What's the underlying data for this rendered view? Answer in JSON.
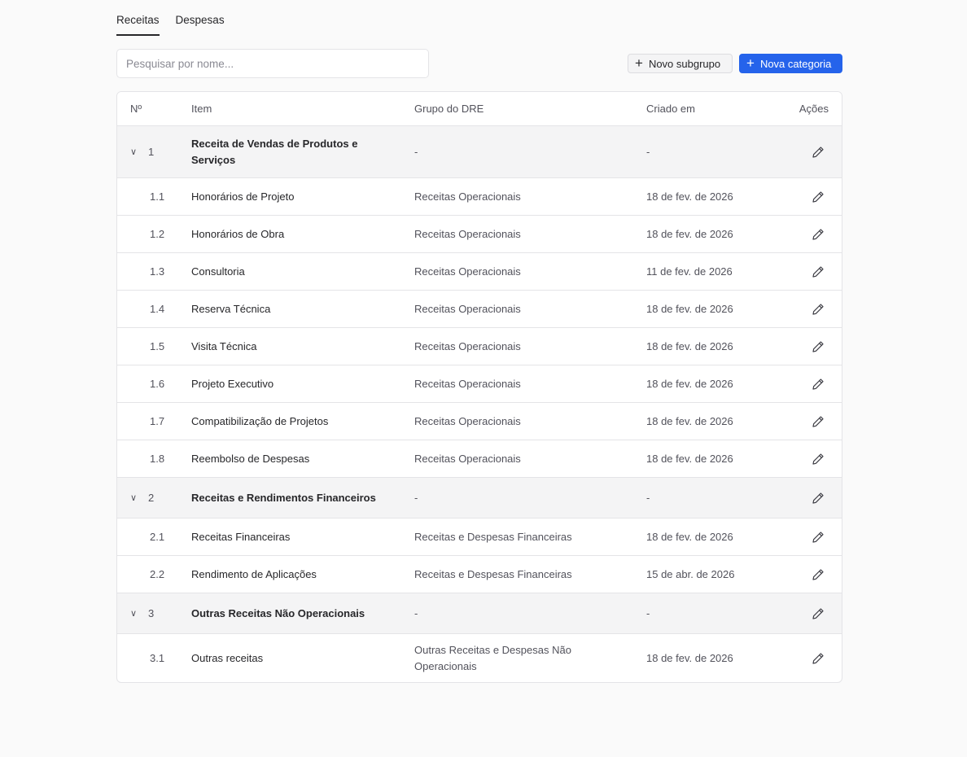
{
  "tabs": [
    {
      "label": "Receitas",
      "active": true
    },
    {
      "label": "Despesas",
      "active": false
    }
  ],
  "search": {
    "placeholder": "Pesquisar por nome..."
  },
  "buttons": {
    "new_subgroup": "Novo subgrupo",
    "new_category": "Nova categoria"
  },
  "colors": {
    "accent": "#2563eb",
    "group_row_bg": "#f4f4f5"
  },
  "table": {
    "headers": {
      "num": "Nº",
      "item": "Item",
      "group": "Grupo do DRE",
      "created": "Criado em",
      "actions": "Ações"
    },
    "rows": [
      {
        "type": "group",
        "num": "1",
        "item": "Receita de Vendas de Produtos e Serviços",
        "group": "-",
        "created": "-"
      },
      {
        "type": "child",
        "num": "1.1",
        "item": "Honorários de Projeto",
        "group": "Receitas Operacionais",
        "created": "18 de fev. de 2026"
      },
      {
        "type": "child",
        "num": "1.2",
        "item": "Honorários de Obra",
        "group": "Receitas Operacionais",
        "created": "18 de fev. de 2026"
      },
      {
        "type": "child",
        "num": "1.3",
        "item": "Consultoria",
        "group": "Receitas Operacionais",
        "created": "11 de fev. de 2026"
      },
      {
        "type": "child",
        "num": "1.4",
        "item": "Reserva Técnica",
        "group": "Receitas Operacionais",
        "created": "18 de fev. de 2026"
      },
      {
        "type": "child",
        "num": "1.5",
        "item": "Visita Técnica",
        "group": "Receitas Operacionais",
        "created": "18 de fev. de 2026"
      },
      {
        "type": "child",
        "num": "1.6",
        "item": "Projeto Executivo",
        "group": "Receitas Operacionais",
        "created": "18 de fev. de 2026"
      },
      {
        "type": "child",
        "num": "1.7",
        "item": "Compatibilização de Projetos",
        "group": "Receitas Operacionais",
        "created": "18 de fev. de 2026"
      },
      {
        "type": "child",
        "num": "1.8",
        "item": "Reembolso de Despesas",
        "group": "Receitas Operacionais",
        "created": "18 de fev. de 2026"
      },
      {
        "type": "group",
        "num": "2",
        "item": "Receitas e Rendimentos Financeiros",
        "group": "-",
        "created": "-"
      },
      {
        "type": "child",
        "num": "2.1",
        "item": "Receitas Financeiras",
        "group": "Receitas e Despesas Financeiras",
        "created": "18 de fev. de 2026"
      },
      {
        "type": "child",
        "num": "2.2",
        "item": "Rendimento de Aplicações",
        "group": "Receitas e Despesas Financeiras",
        "created": "15 de abr. de 2026"
      },
      {
        "type": "group",
        "num": "3",
        "item": "Outras Receitas Não Operacionais",
        "group": "-",
        "created": "-"
      },
      {
        "type": "child",
        "num": "3.1",
        "item": "Outras receitas",
        "group": "Outras Receitas e Despesas Não Operacionais",
        "created": "18 de fev. de 2026"
      }
    ]
  }
}
